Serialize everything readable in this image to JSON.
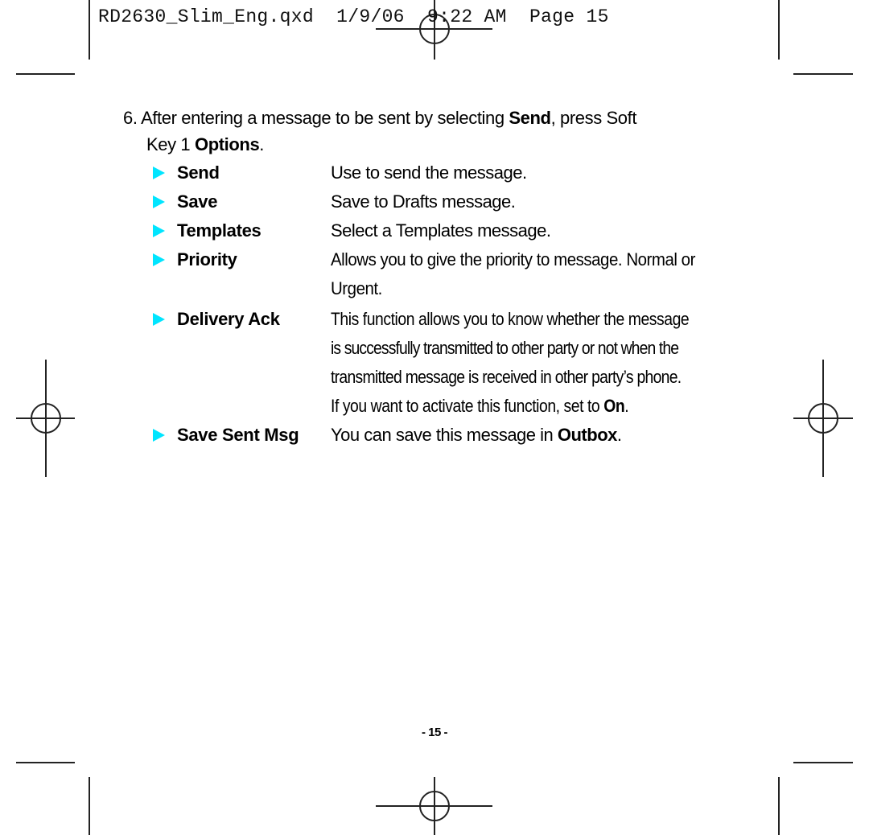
{
  "slug": {
    "filename": "RD2630_Slim_Eng.qxd",
    "date": "1/9/06",
    "time": "9:22 AM",
    "page_label": "Page 15"
  },
  "intro": {
    "number": "6.",
    "text_before": "After entering a message to be sent by selecting ",
    "bold1": "Send",
    "text_middle": ", press Soft",
    "line2_before": "Key 1 ",
    "bold2": "Options",
    "line2_after": "."
  },
  "options": [
    {
      "label": "Send",
      "lines": [
        "Use to send the message."
      ]
    },
    {
      "label": "Save",
      "lines": [
        "Save to Drafts message."
      ]
    },
    {
      "label": "Templates",
      "lines": [
        "Select a Templates message."
      ]
    },
    {
      "label": "Priority",
      "lines": [
        "Allows you to give the priority to  message. Normal or",
        "Urgent."
      ]
    },
    {
      "label": "Delivery Ack",
      "lines": [
        "This function allows you to know whether the message",
        "is successfully transmitted to other party or not when the",
        "transmitted message is received in other party’s phone."
      ],
      "last_before": "If you want to activate this function, set to ",
      "last_bold": "On",
      "last_after": "."
    },
    {
      "label": "Save Sent Msg",
      "last_before": "You can save this message in ",
      "last_bold": "Outbox",
      "last_after": "."
    }
  ],
  "bullet_color": "#00e5ff",
  "page_number": "- 15 -"
}
